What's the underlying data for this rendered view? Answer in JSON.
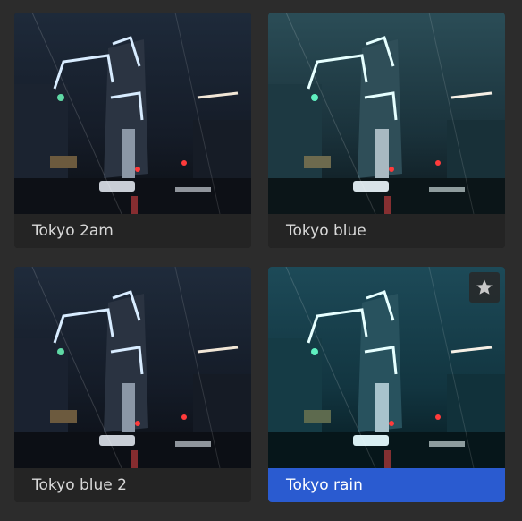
{
  "presets": [
    {
      "label": "Tokyo 2am",
      "variant": "night-neutral",
      "selected": false,
      "favorite": false
    },
    {
      "label": "Tokyo blue",
      "variant": "teal",
      "selected": false,
      "favorite": false
    },
    {
      "label": "Tokyo blue 2",
      "variant": "night-neutral",
      "selected": false,
      "favorite": false
    },
    {
      "label": "Tokyo rain",
      "variant": "deep-teal",
      "selected": true,
      "favorite": true
    }
  ],
  "icons": {
    "favorite": "star-icon"
  },
  "colors": {
    "selected_caption_bg": "#2a5bd0",
    "caption_bg": "#242424",
    "caption_text": "#d9d9d9",
    "panel_bg": "#2c2c2c"
  }
}
